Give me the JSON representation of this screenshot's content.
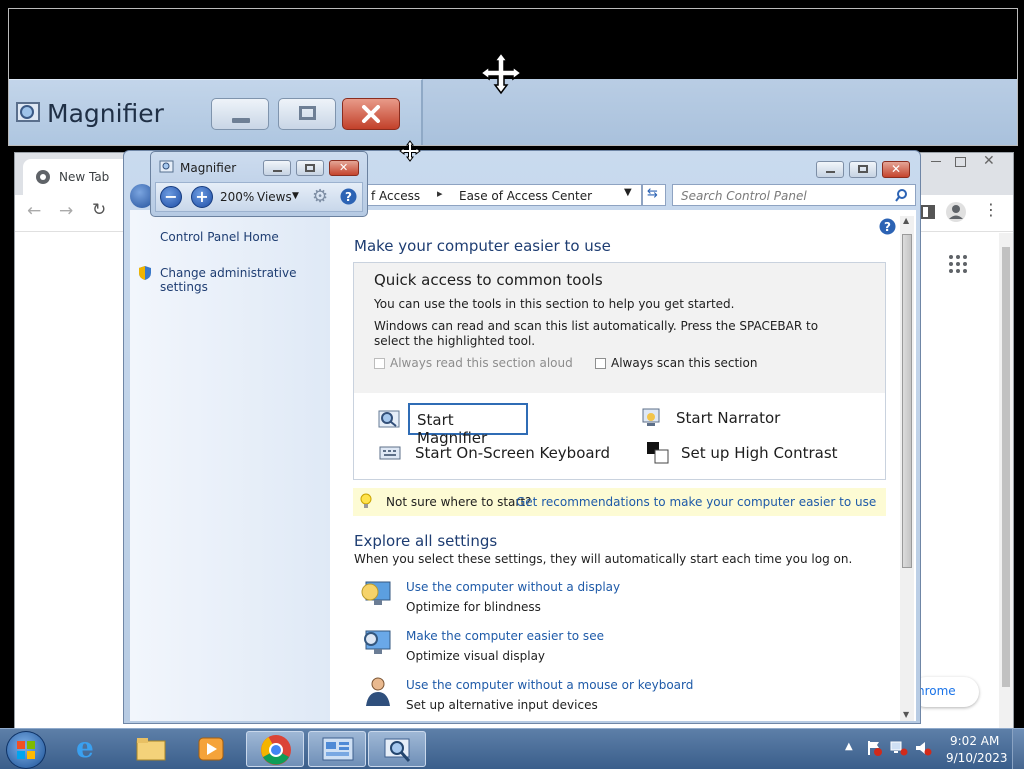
{
  "magnifier_lens": {
    "title": "Magnifier"
  },
  "chrome": {
    "tab_title": "New Tab",
    "bottom_fragment": "hrome"
  },
  "control_panel": {
    "breadcrumb_parent": "f Access",
    "breadcrumb_current": "Ease of Access Center",
    "search_placeholder": "Search Control Panel",
    "nav": {
      "home": "Control Panel Home",
      "admin": "Change administrative settings"
    },
    "heading": "Make your computer easier to use",
    "quick_access": {
      "title": "Quick access to common tools",
      "line1": "You can use the tools in this section to help you get started.",
      "line2": "Windows can read and scan this list automatically.  Press the SPACEBAR to select the highlighted tool.",
      "read_aloud": "Always read this section aloud",
      "scan": "Always scan this section",
      "tools": {
        "magnifier": "Start Magnifier",
        "narrator": "Start Narrator",
        "keyboard": "Start On-Screen Keyboard",
        "contrast": "Set up High Contrast"
      }
    },
    "tip": {
      "text": "Not sure where to start?",
      "link": "Get recommendations to make your computer easier to use"
    },
    "explore": {
      "title": "Explore all settings",
      "subtitle": "When you select these settings, they will automatically start each time you log on.",
      "items": [
        {
          "link": "Use the computer without a display",
          "desc": "Optimize for blindness",
          "icon": "monitor-speaker-icon"
        },
        {
          "link": "Make the computer easier to see",
          "desc": "Optimize visual display",
          "icon": "monitor-icon"
        },
        {
          "link": "Use the computer without a mouse or keyboard",
          "desc": "Set up alternative input devices",
          "icon": "person-icon"
        }
      ]
    }
  },
  "magnifier_toolbar": {
    "title": "Magnifier",
    "zoom": "200%",
    "views": "Views"
  },
  "taskbar": {
    "time": "9:02 AM",
    "date": "9/10/2023"
  },
  "colors": {
    "link": "#1e5aa8",
    "heading": "#1e3d72",
    "tip_background": "#fdfbd4",
    "taskbar": "#4a6f9c"
  }
}
